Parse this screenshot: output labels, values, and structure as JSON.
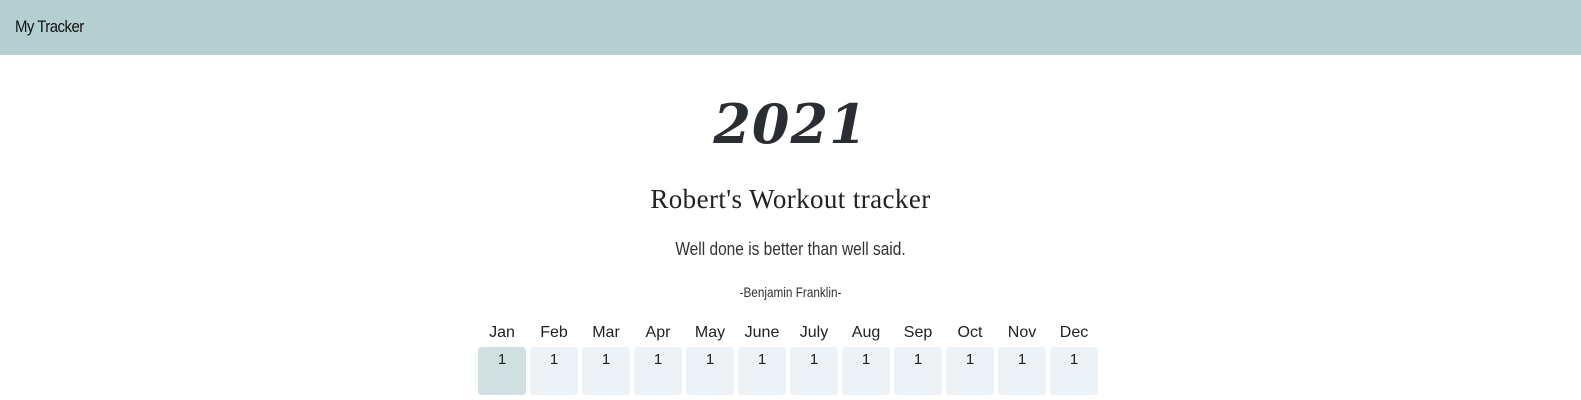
{
  "navbar": {
    "brand": "My Tracker"
  },
  "header": {
    "year": "2021",
    "title": "Robert's Workout tracker",
    "quote": "Well done is better than well said.",
    "author": "-Benjamin Franklin-"
  },
  "months": [
    {
      "label": "Jan",
      "value": "1"
    },
    {
      "label": "Feb",
      "value": "1"
    },
    {
      "label": "Mar",
      "value": "1"
    },
    {
      "label": "Apr",
      "value": "1"
    },
    {
      "label": "May",
      "value": "1"
    },
    {
      "label": "June",
      "value": "1"
    },
    {
      "label": "July",
      "value": "1"
    },
    {
      "label": "Aug",
      "value": "1"
    },
    {
      "label": "Sep",
      "value": "1"
    },
    {
      "label": "Oct",
      "value": "1"
    },
    {
      "label": "Nov",
      "value": "1"
    },
    {
      "label": "Dec",
      "value": "1"
    }
  ],
  "colors": {
    "navbar": "#b3cfd0",
    "cell": "#edf2f6",
    "cell_active": "#d0dfe0"
  }
}
